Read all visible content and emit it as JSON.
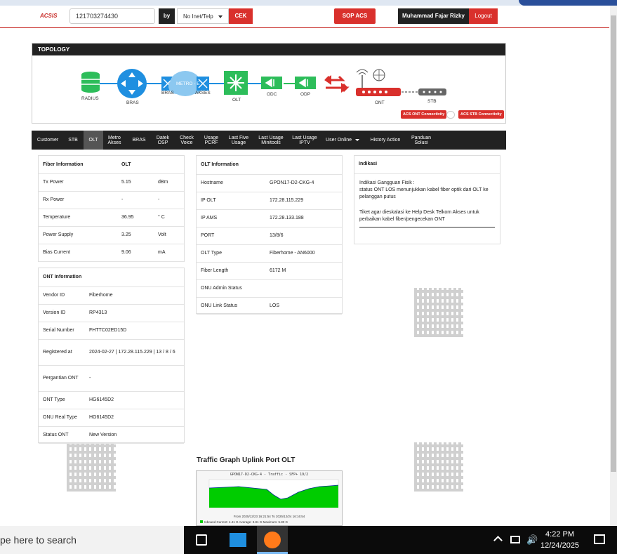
{
  "header": {
    "logo": "ACSIS",
    "search_value": "121703274430",
    "by_label": "by",
    "select_value": "No Inet/Telp",
    "cek_label": "CEK",
    "sop_label": "SOP ACS",
    "user_name": "Muhammad Fajar Rizky",
    "logout_label": "Logout"
  },
  "topology": {
    "title": "TOPOLOGY",
    "nodes": [
      "RADIUS",
      "BRAS",
      "BRAS",
      "METRO - E",
      "AKSES",
      "OLT",
      "ODC",
      "ODP",
      "ONT",
      "STB"
    ],
    "acs_ont": "ACS ONT Connectivity",
    "acs_stb": "ACS STB Connectivity"
  },
  "nav": {
    "items": [
      "Customer",
      "STB",
      "OLT",
      "Metro Akses",
      "BRAS",
      "Datek OSP",
      "Check Voice",
      "Usage PCRF",
      "Last Five Usage",
      "Last Usage Minitools",
      "Last Usage IPTV",
      "User Online",
      "History Action",
      "Panduan Solusi"
    ]
  },
  "fiber": {
    "header": [
      "Fiber Information",
      "OLT"
    ],
    "rows": [
      [
        "Tx Power",
        "5.15",
        "dBm"
      ],
      [
        "Rx Power",
        "-",
        "-"
      ],
      [
        "Temperature",
        "36.95",
        "° C"
      ],
      [
        "Power Supply",
        "3.25",
        "Volt"
      ],
      [
        "Bias Current",
        "9.06",
        "mA"
      ]
    ]
  },
  "ont": {
    "title": "ONT Information",
    "rows": [
      [
        "Vendor ID",
        "Fiberhome"
      ],
      [
        "Version ID",
        "RP4313"
      ],
      [
        "Serial Number",
        "FHTTC02ED15D"
      ],
      [
        "Registered at",
        "2024-02-27 | 172.28.115.229 | 13 / 8 / 6"
      ],
      [
        "Pergantian ONT",
        "-"
      ],
      [
        "ONT Type",
        "HG6145D2"
      ],
      [
        "ONU Real Type",
        "HG6145D2"
      ],
      [
        "Status ONT",
        "New Version"
      ]
    ]
  },
  "olt": {
    "title": "OLT Information",
    "rows": [
      [
        "Hostname",
        "GPON17-D2-CKG-4"
      ],
      [
        "IP OLT",
        "172.28.115.229"
      ],
      [
        "IP AMS",
        "172.28.133.188"
      ],
      [
        "PORT",
        "13/8/6"
      ],
      [
        "OLT Type",
        "Fiberhome - AN6000"
      ],
      [
        "Fiber Length",
        "6172 M"
      ],
      [
        "ONU Admin Status",
        ""
      ],
      [
        "ONU Link Status",
        "LOS"
      ]
    ]
  },
  "indikasi": {
    "title": "Indikasi",
    "line1": "Indikasi Gangguan Fisik :",
    "line2": "status ONT LOS menunjukkan kabel fiber optik dari OLT ke pelanggan putus",
    "line3": "Tiket agar dieskalasi ke Help Desk Telkom Akses untuk perbaikan kabel fiber/pengecekan ONT"
  },
  "traffic": {
    "title": "Traffic Graph Uplink Port OLT",
    "graph_title": "GPON17-D2-CKG-4 - Traffic - SFP+ 19/2",
    "graph_range": "From 2025/12/23 16:21:54 To 2025/12/24 16:16:54",
    "legend_inbound": "Inbound   Current:   4.41 G   Average:   3.81 G   Maximum:   5.80 G"
  },
  "taskbar": {
    "search_placeholder": "pe here to search",
    "time": "4:22 PM",
    "date": "12/24/2025"
  },
  "colors": {
    "accent": "#d9302c",
    "dark": "#222222",
    "node_blue": "#1f8fe0",
    "node_green": "#2dbd5a"
  }
}
